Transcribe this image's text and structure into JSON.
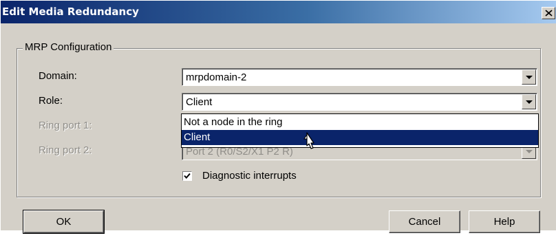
{
  "window": {
    "title": "Edit Media Redundancy",
    "close_symbol": "✕"
  },
  "group": {
    "legend": "MRP Configuration"
  },
  "fields": {
    "domain": {
      "label": "Domain:",
      "value": "mrpdomain-2"
    },
    "role": {
      "label": "Role:",
      "value": "Client"
    },
    "ring_port_1": {
      "label": "Ring port 1:",
      "value": ""
    },
    "ring_port_2": {
      "label": "Ring port 2:",
      "value": "Port 2 (R0/S2/X1 P2 R)"
    }
  },
  "role_dropdown": {
    "options": [
      "Not a node in the ring",
      "Client"
    ],
    "selected": "Client"
  },
  "diagnostic_interrupts": {
    "label": "Diagnostic interrupts",
    "checked": true
  },
  "buttons": {
    "ok": "OK",
    "cancel": "Cancel",
    "help": "Help"
  },
  "icons": {
    "close": "close-icon",
    "dropdown": "chevron-down-icon",
    "check": "checkmark-icon",
    "cursor": "mouse-pointer-icon"
  },
  "colors": {
    "title_bar_start": "#0a246a",
    "title_bar_end": "#a6caf0",
    "dialog_bg": "#d4d0c8",
    "selection": "#0a246a"
  }
}
